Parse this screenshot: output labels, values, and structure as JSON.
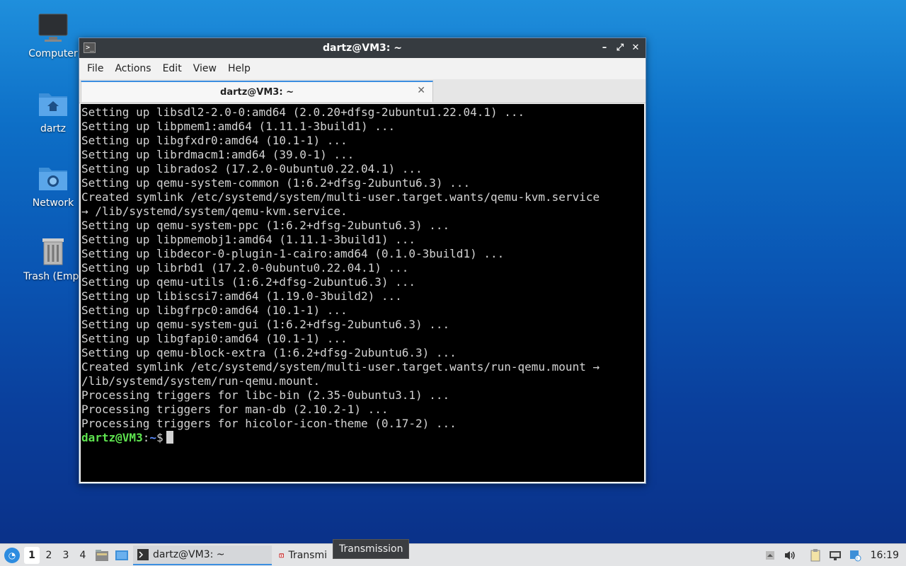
{
  "desktop": {
    "icons": [
      {
        "label": "Computer",
        "icon": "monitor-icon"
      },
      {
        "label": "dartz",
        "icon": "home-folder-icon"
      },
      {
        "label": "Network",
        "icon": "network-folder-icon"
      },
      {
        "label": "Trash (Empt",
        "icon": "trash-icon"
      }
    ]
  },
  "window": {
    "title": "dartz@VM3: ~",
    "buttons": [
      "minimize",
      "maximize",
      "close"
    ],
    "button_glyphs": {
      "minimize": "–",
      "maximize": "⤢",
      "close": "✕"
    },
    "menu": [
      "File",
      "Actions",
      "Edit",
      "View",
      "Help"
    ],
    "tab": {
      "label": "dartz@VM3: ~",
      "close_glyph": "✕"
    }
  },
  "terminal": {
    "lines": [
      "Setting up libsdl2-2.0-0:amd64 (2.0.20+dfsg-2ubuntu1.22.04.1) ...",
      "Setting up libpmem1:amd64 (1.11.1-3build1) ...",
      "Setting up libgfxdr0:amd64 (10.1-1) ...",
      "Setting up librdmacm1:amd64 (39.0-1) ...",
      "Setting up librados2 (17.2.0-0ubuntu0.22.04.1) ...",
      "Setting up qemu-system-common (1:6.2+dfsg-2ubuntu6.3) ...",
      "Created symlink /etc/systemd/system/multi-user.target.wants/qemu-kvm.service",
      "→ /lib/systemd/system/qemu-kvm.service.",
      "Setting up qemu-system-ppc (1:6.2+dfsg-2ubuntu6.3) ...",
      "Setting up libpmemobj1:amd64 (1.11.1-3build1) ...",
      "Setting up libdecor-0-plugin-1-cairo:amd64 (0.1.0-3build1) ...",
      "Setting up librbd1 (17.2.0-0ubuntu0.22.04.1) ...",
      "Setting up qemu-utils (1:6.2+dfsg-2ubuntu6.3) ...",
      "Setting up libiscsi7:amd64 (1.19.0-3build2) ...",
      "Setting up libgfrpc0:amd64 (10.1-1) ...",
      "Setting up qemu-system-gui (1:6.2+dfsg-2ubuntu6.3) ...",
      "Setting up libgfapi0:amd64 (10.1-1) ...",
      "Setting up qemu-block-extra (1:6.2+dfsg-2ubuntu6.3) ...",
      "Created symlink /etc/systemd/system/multi-user.target.wants/run-qemu.mount →",
      "/lib/systemd/system/run-qemu.mount.",
      "Processing triggers for libc-bin (2.35-0ubuntu3.1) ...",
      "Processing triggers for man-db (2.10.2-1) ...",
      "Processing triggers for hicolor-icon-theme (0.17-2) ..."
    ],
    "prompt": {
      "user_host": "dartz@VM3",
      "sep": ":",
      "path": "~",
      "symbol": "$"
    }
  },
  "taskbar": {
    "workspaces": [
      "1",
      "2",
      "3",
      "4"
    ],
    "active_workspace": "1",
    "tasks": [
      {
        "label": "dartz@VM3: ~",
        "icon": "terminal-icon",
        "active": true
      },
      {
        "label": "Transmi",
        "icon": "transmission-icon",
        "active": false
      }
    ],
    "tooltip": "Transmission",
    "clock": "16:19"
  },
  "colors": {
    "prompt_user": "#5ee34f",
    "prompt_path": "#5c8dff",
    "accent": "#3b8ee0"
  }
}
